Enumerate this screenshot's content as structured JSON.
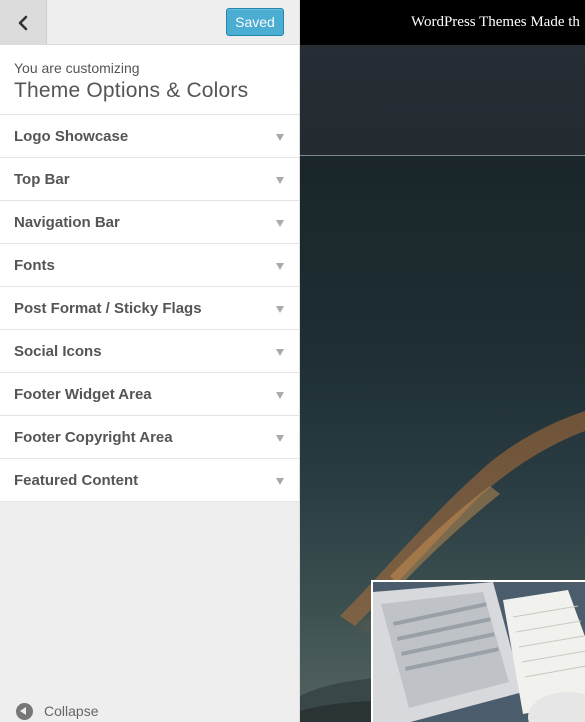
{
  "header": {
    "back_label": "Back",
    "saved_label": "Saved"
  },
  "customizer": {
    "action_text": "You are customizing",
    "title": "Theme Options & Colors"
  },
  "sections": [
    "Logo Showcase",
    "Top Bar",
    "Navigation Bar",
    "Fonts",
    "Post Format / Sticky Flags",
    "Social Icons",
    "Footer Widget Area",
    "Footer Copyright Area",
    "Featured Content"
  ],
  "footer": {
    "collapse_label": "Collapse"
  },
  "preview": {
    "topbar_text": "WordPress Themes Made th"
  },
  "colors": {
    "accent": "#2ea2cc",
    "sidebar_bg": "#eeeeee",
    "topbar_bg": "#000000"
  }
}
